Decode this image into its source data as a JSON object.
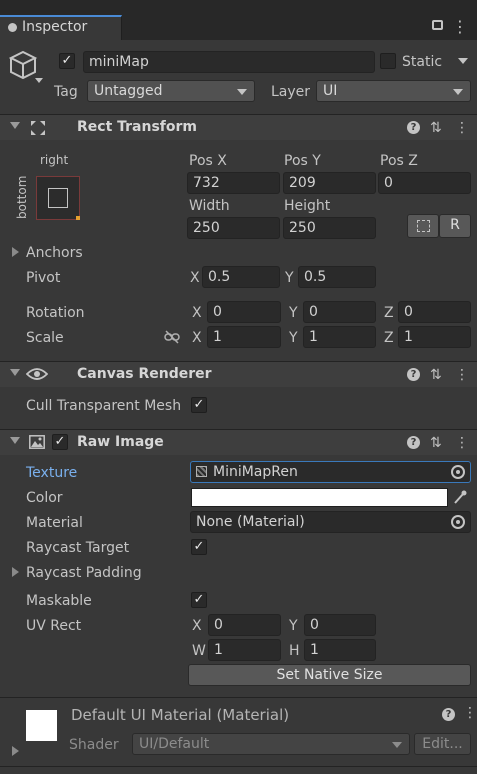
{
  "tab": {
    "title": "Inspector"
  },
  "object": {
    "name": "miniMap",
    "active": true,
    "static_label": "Static",
    "static": false,
    "tag_label": "Tag",
    "tag_value": "Untagged",
    "layer_label": "Layer",
    "layer_value": "UI"
  },
  "rect_transform": {
    "title": "Rect Transform",
    "anchor_preset_h": "right",
    "anchor_preset_v": "bottom",
    "labels": {
      "pos_x": "Pos X",
      "pos_y": "Pos Y",
      "pos_z": "Pos Z",
      "width": "Width",
      "height": "Height"
    },
    "values": {
      "pos_x": "732",
      "pos_y": "209",
      "pos_z": "0",
      "width": "250",
      "height": "250"
    },
    "anchors_label": "Anchors",
    "pivot_label": "Pivot",
    "pivot": {
      "x": "0.5",
      "y": "0.5"
    },
    "rotation_label": "Rotation",
    "rotation": {
      "x": "0",
      "y": "0",
      "z": "0"
    },
    "scale_label": "Scale",
    "scale": {
      "x": "1",
      "y": "1",
      "z": "1"
    },
    "axis": {
      "x": "X",
      "y": "Y",
      "z": "Z"
    },
    "raw_edit_label": "R"
  },
  "canvas_renderer": {
    "title": "Canvas Renderer",
    "cull_label": "Cull Transparent Mesh",
    "cull": true
  },
  "raw_image": {
    "title": "Raw Image",
    "enabled": true,
    "texture_label": "Texture",
    "texture_value": "MiniMapRen",
    "color_label": "Color",
    "color_value": "#ffffff",
    "material_label": "Material",
    "material_value": "None (Material)",
    "raycast_target_label": "Raycast Target",
    "raycast_target": true,
    "raycast_padding_label": "Raycast Padding",
    "maskable_label": "Maskable",
    "maskable": true,
    "uv_rect_label": "UV Rect",
    "uv": {
      "x": "0",
      "y": "0",
      "w": "1",
      "h": "1"
    },
    "uv_axis": {
      "x": "X",
      "y": "Y",
      "w": "W",
      "h": "H"
    },
    "native_size_button": "Set Native Size"
  },
  "material_preview": {
    "title": "Default UI Material (Material)",
    "shader_label": "Shader",
    "shader_value": "UI/Default",
    "edit_button": "Edit..."
  },
  "icons": {
    "help": "?",
    "presets": "⇅",
    "menu": "⋮",
    "check": "✓",
    "lock": "🔒"
  }
}
